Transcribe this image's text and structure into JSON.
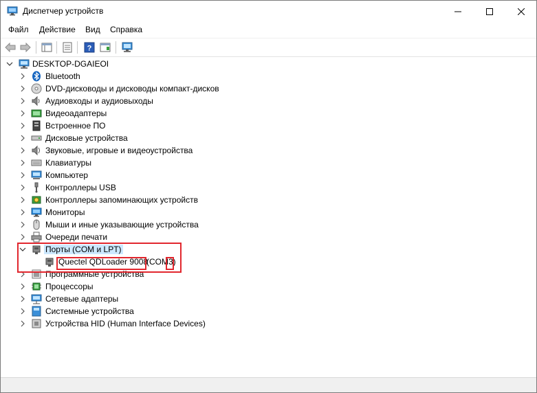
{
  "window": {
    "title": "Диспетчер устройств"
  },
  "menu": [
    "Файл",
    "Действие",
    "Вид",
    "Справка"
  ],
  "tree": {
    "root": "DESKTOP-DGAIEOI",
    "categories": [
      {
        "label": "Bluetooth",
        "icon": "bluetooth-icon"
      },
      {
        "label": "DVD-дисководы и дисководы компакт-дисков",
        "icon": "dvd-drive-icon"
      },
      {
        "label": "Аудиовходы и аудиовыходы",
        "icon": "audio-io-icon"
      },
      {
        "label": "Видеоадаптеры",
        "icon": "display-adapter-icon"
      },
      {
        "label": "Встроенное ПО",
        "icon": "firmware-icon"
      },
      {
        "label": "Дисковые устройства",
        "icon": "disk-drive-icon"
      },
      {
        "label": "Звуковые, игровые и видеоустройства",
        "icon": "sound-icon"
      },
      {
        "label": "Клавиатуры",
        "icon": "keyboard-icon"
      },
      {
        "label": "Компьютер",
        "icon": "computer-icon"
      },
      {
        "label": "Контроллеры USB",
        "icon": "usb-icon"
      },
      {
        "label": "Контроллеры запоминающих устройств",
        "icon": "storage-controller-icon"
      },
      {
        "label": "Мониторы",
        "icon": "monitor-icon"
      },
      {
        "label": "Мыши и иные указывающие устройства",
        "icon": "mouse-icon"
      },
      {
        "label": "Очереди печати",
        "icon": "printer-icon"
      },
      {
        "label": "Порты (COM и LPT)",
        "icon": "port-icon",
        "expanded": true,
        "selected": true
      },
      {
        "label": "Программные устройства",
        "icon": "software-device-icon"
      },
      {
        "label": "Процессоры",
        "icon": "processor-icon"
      },
      {
        "label": "Сетевые адаптеры",
        "icon": "network-adapter-icon"
      },
      {
        "label": "Системные устройства",
        "icon": "system-device-icon"
      },
      {
        "label": "Устройства HID (Human Interface Devices)",
        "icon": "hid-icon"
      }
    ],
    "port_device": {
      "name": "Quectel QDLoader 9008",
      "port": "(COM3)"
    }
  },
  "colors": {
    "highlight": "#e1262d",
    "selection": "#cce8ff"
  }
}
